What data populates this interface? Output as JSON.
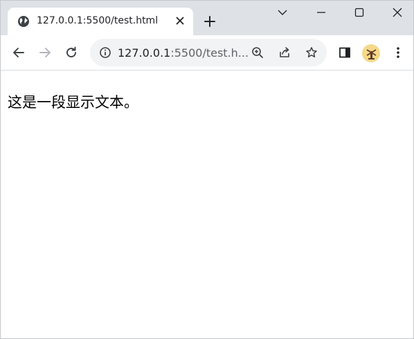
{
  "browser": {
    "tab": {
      "title": "127.0.0.1:5500/test.html",
      "favicon_icon": "globe-icon",
      "close_icon": "close-icon"
    },
    "new_tab_icon": "plus-icon",
    "window_controls": [
      "chevron-down-icon",
      "minimize-icon",
      "maximize-icon",
      "close-icon"
    ],
    "toolbar": {
      "back_icon": "arrow-left-icon",
      "forward_icon": "arrow-right-icon",
      "reload_icon": "reload-icon",
      "side_panel_icon": "side-panel-icon",
      "menu_icon": "kebab-menu-icon"
    },
    "omnibox": {
      "info_icon": "info-icon",
      "url_host": "127.0.0.1",
      "url_rest": ":5500/test.h...",
      "zoom_icon": "zoom-in-icon",
      "share_icon": "share-icon",
      "bookmark_icon": "star-icon"
    },
    "profile": {
      "avatar_icon": "profile-avatar-icon"
    }
  },
  "page": {
    "text": "这是一段显示文本。"
  },
  "colors": {
    "tabstrip_bg": "#dee1e6",
    "omnibox_bg": "#f1f3f4",
    "icon_color": "#5f6368",
    "forward_disabled": "#b0b4ba",
    "avatar_bg": "#f6d889"
  }
}
